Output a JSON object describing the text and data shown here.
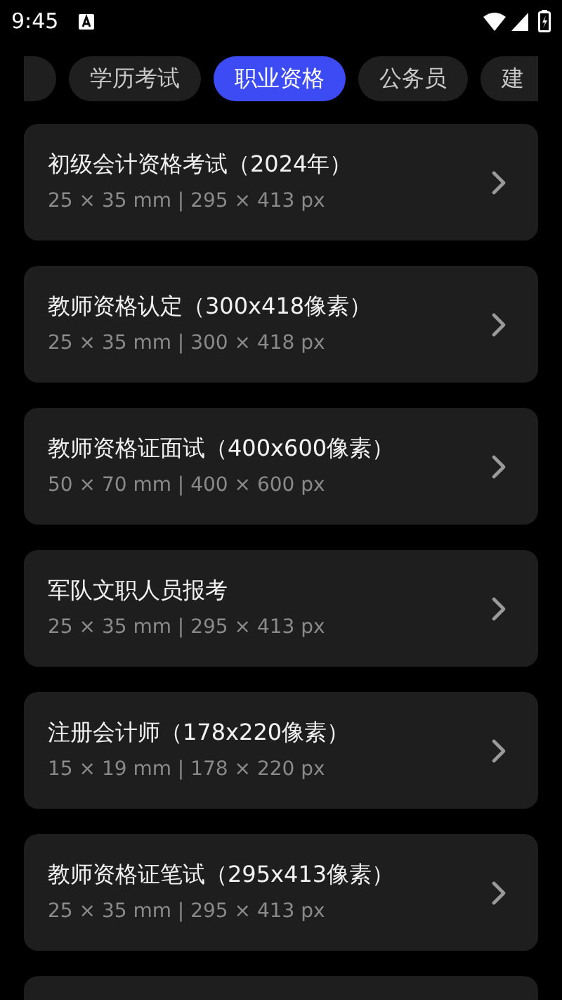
{
  "status_bar": {
    "time": "9:45"
  },
  "tabs": [
    {
      "selected": false
    },
    {
      "label": "学历考试",
      "selected": false
    },
    {
      "label": "职业资格",
      "selected": true
    },
    {
      "label": "公务员",
      "selected": false
    },
    {
      "label": "建",
      "selected": false
    }
  ],
  "items": [
    {
      "title": "初级会计资格考试（2024年）",
      "size": "25 × 35 mm | 295 × 413 px"
    },
    {
      "title": "教师资格认定（300x418像素）",
      "size": "25 × 35 mm | 300 × 418 px"
    },
    {
      "title": "教师资格证面试（400x600像素）",
      "size": "50 × 70 mm | 400 × 600 px"
    },
    {
      "title": "军队文职人员报考",
      "size": "25 × 35 mm | 295 × 413 px"
    },
    {
      "title": "注册会计师（178x220像素）",
      "size": "15 × 19 mm | 178 × 220 px"
    },
    {
      "title": "教师资格证笔试（295x413像素）",
      "size": "25 × 35 mm | 295 × 413 px"
    }
  ]
}
